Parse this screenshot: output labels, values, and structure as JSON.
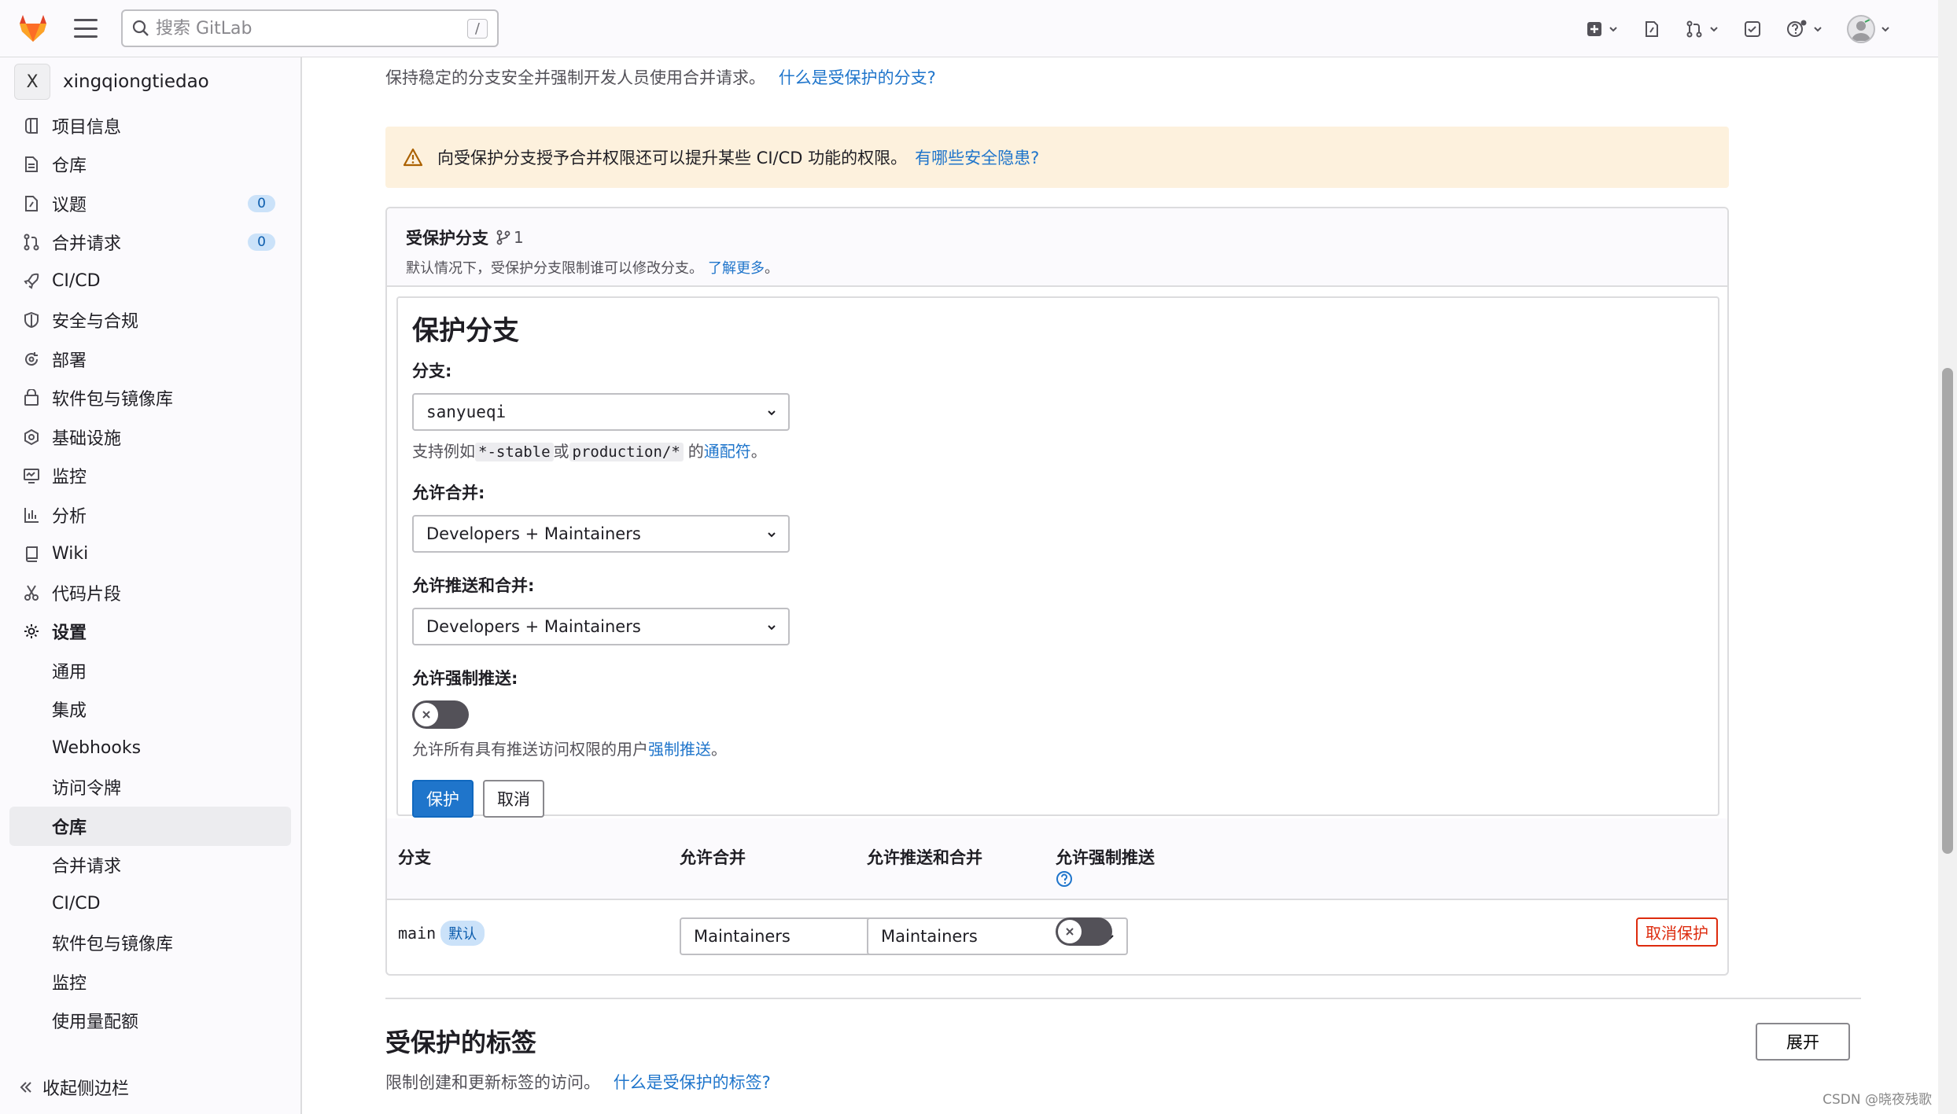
{
  "topbar": {
    "search_placeholder": "搜索 GitLab",
    "search_shortcut": "/"
  },
  "sidebar": {
    "project_initial": "X",
    "project_name": "xingqiongtiedao",
    "items": [
      {
        "label": "项目信息",
        "icon": "info-icon"
      },
      {
        "label": "仓库",
        "icon": "document-icon"
      },
      {
        "label": "议题",
        "icon": "issues-icon",
        "badge": "0"
      },
      {
        "label": "合并请求",
        "icon": "merge-request-icon",
        "badge": "0"
      },
      {
        "label": "CI/CD",
        "icon": "rocket-icon"
      },
      {
        "label": "安全与合规",
        "icon": "shield-icon"
      },
      {
        "label": "部署",
        "icon": "deployments-icon"
      },
      {
        "label": "软件包与镜像库",
        "icon": "package-icon"
      },
      {
        "label": "基础设施",
        "icon": "cloud-gear-icon"
      },
      {
        "label": "监控",
        "icon": "monitor-icon"
      },
      {
        "label": "分析",
        "icon": "chart-icon"
      },
      {
        "label": "Wiki",
        "icon": "book-icon"
      },
      {
        "label": "代码片段",
        "icon": "scissors-icon"
      },
      {
        "label": "设置",
        "icon": "settings-icon"
      }
    ],
    "settings_sub": [
      {
        "label": "通用"
      },
      {
        "label": "集成"
      },
      {
        "label": "Webhooks"
      },
      {
        "label": "访问令牌"
      },
      {
        "label": "仓库"
      },
      {
        "label": "合并请求"
      },
      {
        "label": "CI/CD"
      },
      {
        "label": "软件包与镜像库"
      },
      {
        "label": "监控"
      },
      {
        "label": "使用量配额"
      }
    ],
    "collapse_label": "收起侧边栏"
  },
  "main": {
    "intro_text": "保持稳定的分支安全并强制开发人员使用合并请求。",
    "intro_link": "什么是受保护的分支?",
    "alert_text": "向受保护分支授予合并权限还可以提升某些 CI/CD 功能的权限。",
    "alert_link": "有哪些安全隐患?",
    "card": {
      "title": "受保护分支",
      "count": "1",
      "desc": "默认情况下，受保护分支限制谁可以修改分支。",
      "desc_link": "了解更多",
      "desc_end": "。"
    },
    "form": {
      "heading": "保护分支",
      "branch_label": "分支:",
      "branch_value": "sanyueqi",
      "branch_help_1": "支持例如",
      "branch_help_code1": "*-stable",
      "branch_help_2": "或",
      "branch_help_code2": "production/*",
      "branch_help_3": "的",
      "branch_help_link": "通配符",
      "branch_help_end": "。",
      "merge_label": "允许合并:",
      "merge_value": "Developers + Maintainers",
      "push_label": "允许推送和合并:",
      "push_value": "Developers + Maintainers",
      "force_label": "允许强制推送:",
      "force_enabled": false,
      "force_help": "允许所有具有推送访问权限的用户",
      "force_help_link": "强制推送",
      "force_help_end": "。",
      "protect_button": "保护",
      "cancel_button": "取消"
    },
    "table": {
      "headers": [
        "分支",
        "允许合并",
        "允许推送和合并",
        "允许强制推送"
      ],
      "rows": [
        {
          "branch": "main",
          "tag": "默认",
          "merge": "Maintainers",
          "push": "Maintainers",
          "force_enabled": false,
          "action": "取消保护"
        }
      ]
    },
    "tags_section": {
      "title": "受保护的标签",
      "desc": "限制创建和更新标签的访问。",
      "link": "什么是受保护的标签?",
      "expand_button": "展开"
    }
  },
  "watermark": "CSDN @晓夜残歌"
}
